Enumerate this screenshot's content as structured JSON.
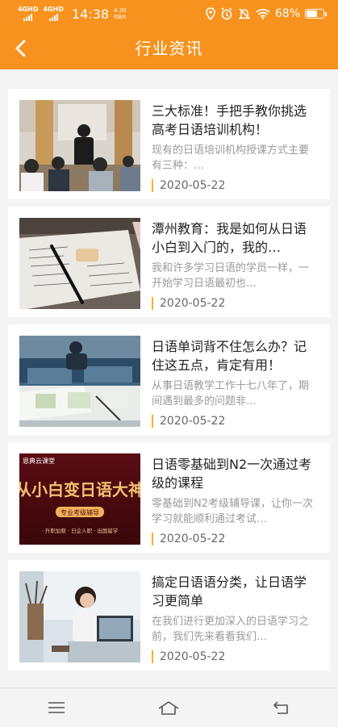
{
  "status_bar": {
    "network_1": "4GHD",
    "network_2": "4GHD",
    "time": "14:38",
    "speed_value": "4.30",
    "speed_unit": "KB/s",
    "battery": "68%",
    "battery_level": 0.68
  },
  "header": {
    "title": "行业资讯",
    "back_icon": "chevron-left-icon",
    "background": "#f7921e"
  },
  "articles": [
    {
      "title": "三大标准！手把手教你挑选高考日语培训机构！",
      "summary": "现有的日语培训机构授课方式主要有三种：…",
      "date": "2020-05-22",
      "image": "classroom-teacher-photo"
    },
    {
      "title": "潭州教育：我是如何从日语小白到入门的，我的…",
      "summary": "我和许多学习日语的学员一样，一开始学习日语最初也…",
      "date": "2020-05-22",
      "image": "notebook-pen-photo"
    },
    {
      "title": "日语单词背不住怎么办？记住这五点，肯定有用！",
      "summary": "从事日语教学工作十七八年了，期间遇到最多的问题非…",
      "date": "2020-05-22",
      "image": "students-studying-photo"
    },
    {
      "title": "日语零基础到N2一次通过考级的课程",
      "summary": "零基础到N2考级辅导课，让你一次学习就能顺利通过考试…",
      "date": "2020-05-22",
      "image": "course-banner",
      "banner": {
        "brand": "恩典云课堂",
        "headline": "从小白变日语大神",
        "badge": "专业考级辅导",
        "tags": "· 升职加薪  · 日企入职  · 出国留学"
      }
    },
    {
      "title": "搞定日语语分类，让日语学习更简单",
      "summary": "在我们进行更加深入的日语学习之前，我们先来看看我们…",
      "date": "2020-05-22",
      "image": "woman-laptop-photo"
    }
  ],
  "bottom_nav": {
    "menu_icon": "menu-icon",
    "home_icon": "home-icon",
    "back_icon": "back-icon"
  }
}
